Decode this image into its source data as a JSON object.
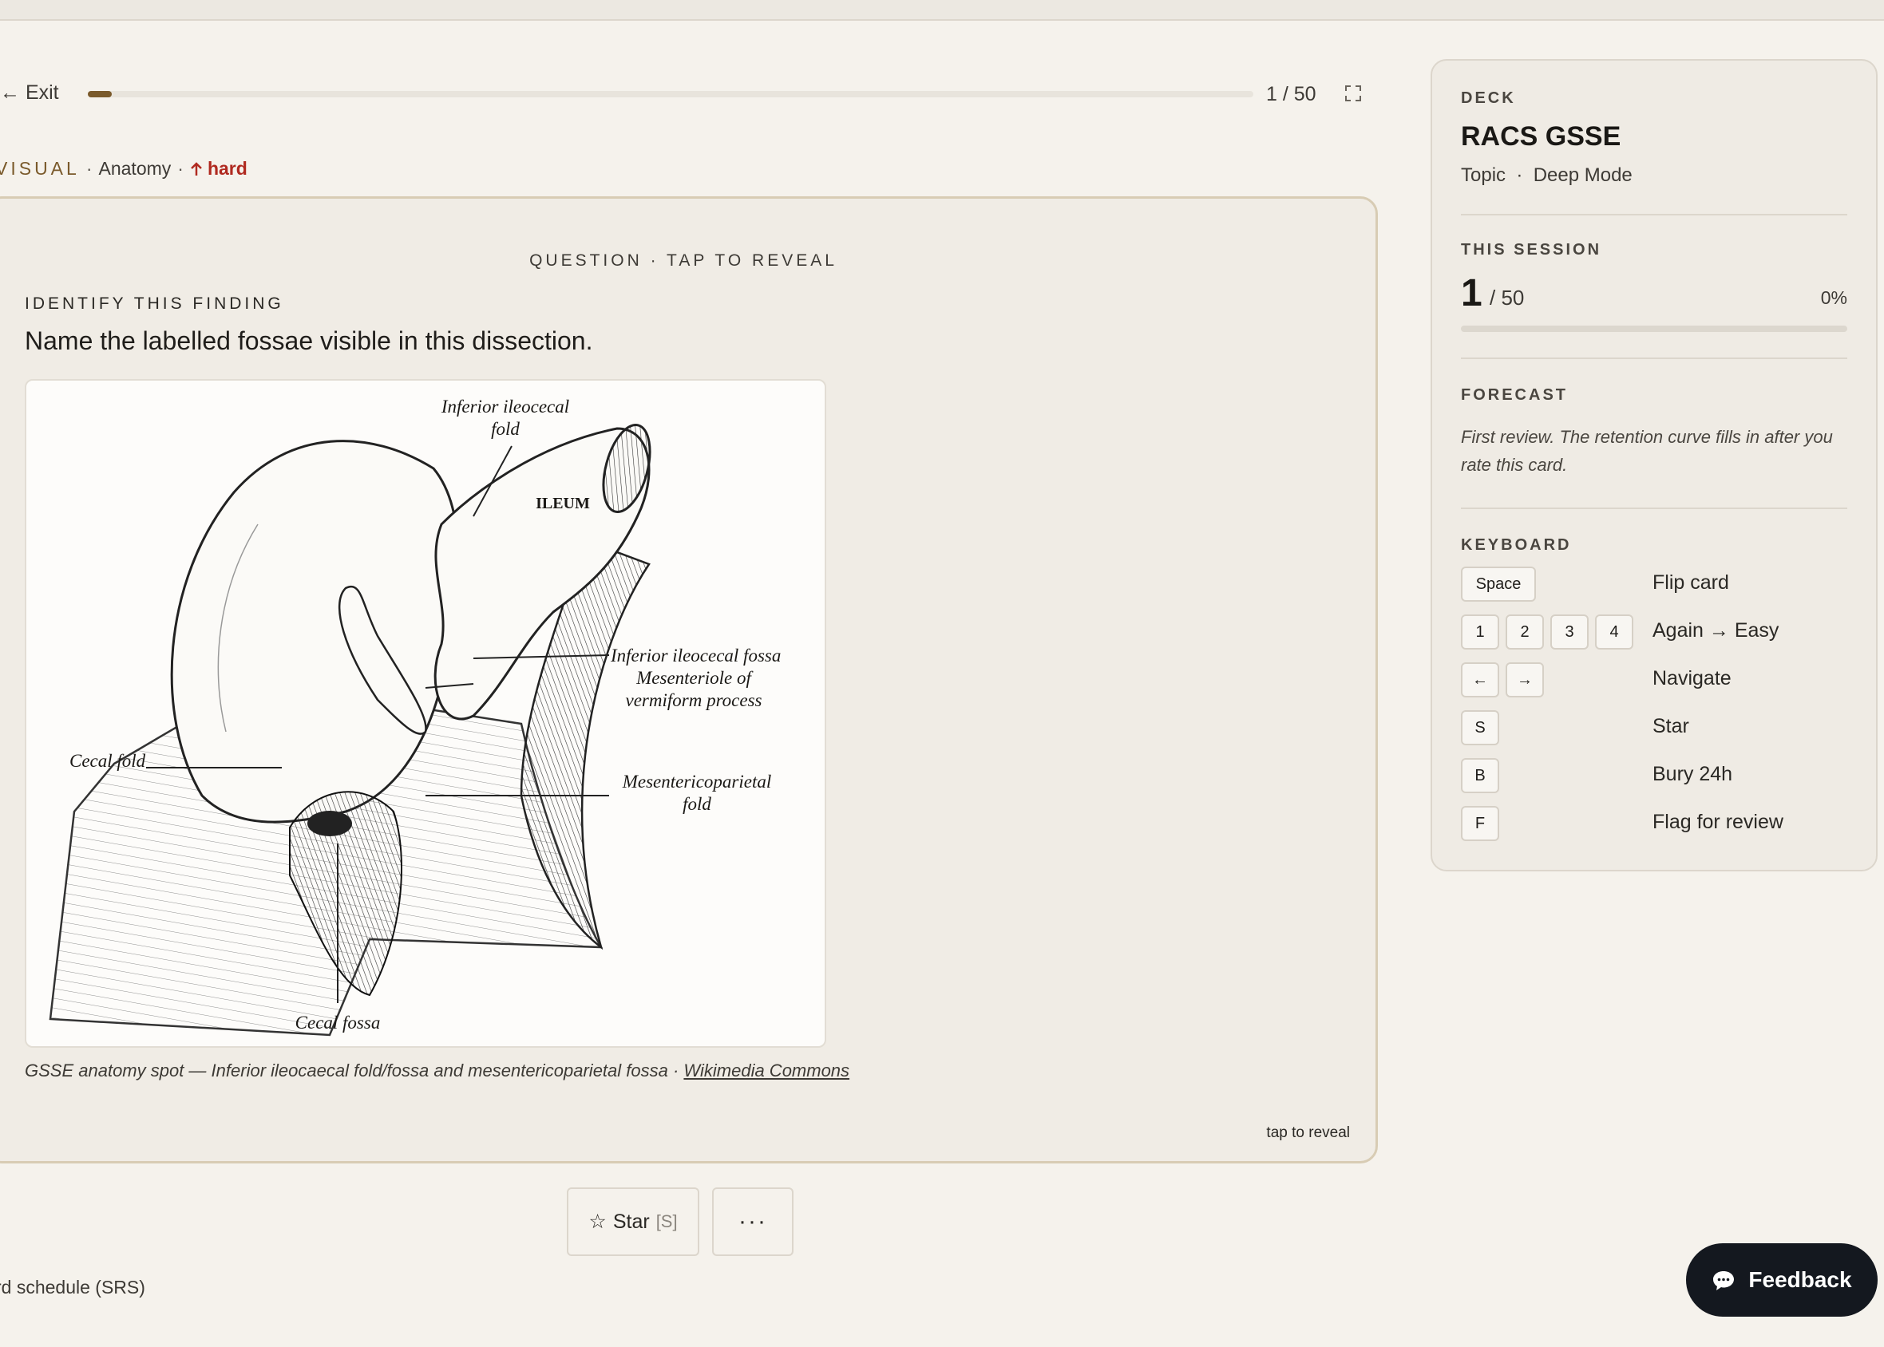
{
  "nav": {
    "exit_label": "← Exit",
    "counter": "1 / 50",
    "progress_fraction": 0.02
  },
  "tags": {
    "type": "VISUAL",
    "topic": "Anatomy",
    "difficulty": "hard"
  },
  "card": {
    "header": "QUESTION · TAP TO REVEAL",
    "finding_label": "IDENTIFY THIS FINDING",
    "prompt": "Name the labelled fossae visible in this dissection.",
    "image_labels": {
      "inferior_ileocecal_fold_1": "Inferior ileocecal",
      "inferior_ileocecal_fold_2": "fold",
      "ileum": "ILEUM",
      "inferior_ileocecal_fossa": "Inferior ileocecal fossa",
      "mesenteriole_1": "Mesenteriole of",
      "mesenteriole_2": "vermiform process",
      "mesentericoparietal_1": "Mesentericoparietal",
      "mesentericoparietal_2": "fold",
      "cecal_fold": "Cecal fold",
      "cecal_fossa": "Cecal fossa"
    },
    "caption": "GSSE anatomy spot — Inferior ileocaecal fold/fossa and mesentericoparietal fossa · ",
    "caption_link": "Wikimedia Commons",
    "tap_to_reveal": "tap to reveal"
  },
  "actions": {
    "star_label": "Star",
    "star_key": "[S]",
    "more_label": "···"
  },
  "srs_note": "rd schedule (SRS)",
  "sidebar": {
    "deck_label": "DECK",
    "deck_name": "RACS GSSE",
    "deck_sub": "Topic  ·  Deep Mode",
    "session_label": "THIS SESSION",
    "session_current": "1",
    "session_total": "/ 50",
    "session_pct": "0%",
    "forecast_label": "FORECAST",
    "forecast_text": "First review. The retention curve fills in after you rate this card.",
    "keyboard_label": "KEYBOARD",
    "shortcuts": [
      {
        "keys": [
          "Space"
        ],
        "desc": "Flip card"
      },
      {
        "keys": [
          "1",
          "2",
          "3",
          "4"
        ],
        "desc": "Again → Easy"
      },
      {
        "keys": [
          "←",
          "→"
        ],
        "desc": "Navigate"
      },
      {
        "keys": [
          "S"
        ],
        "desc": "Star"
      },
      {
        "keys": [
          "B"
        ],
        "desc": "Bury 24h"
      },
      {
        "keys": [
          "F"
        ],
        "desc": "Flag for review"
      }
    ]
  },
  "feedback_label": "Feedback",
  "colors": {
    "accent": "#7a5a2b",
    "hard": "#b02a20",
    "background": "#f5f2ec",
    "card_border": "#d8ccb4",
    "feedback_bg": "#14181f"
  }
}
